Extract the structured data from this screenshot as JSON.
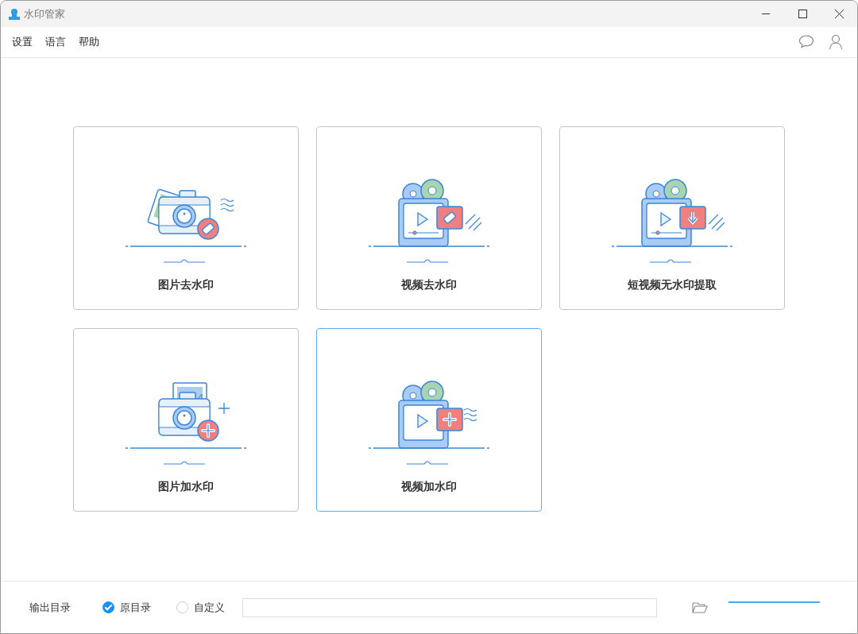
{
  "window": {
    "title": "水印管家"
  },
  "menu": [
    "设置",
    "语言",
    "帮助"
  ],
  "cards": [
    {
      "kind": "photo-remove",
      "label": "图片去水印",
      "selected": false
    },
    {
      "kind": "video-remove",
      "label": "视频去水印",
      "selected": false
    },
    {
      "kind": "video-extract",
      "label": "短视频无水印提取",
      "selected": false
    },
    {
      "kind": "photo-add",
      "label": "图片加水印",
      "selected": false
    },
    {
      "kind": "video-add",
      "label": "视频加水印",
      "selected": true
    }
  ],
  "output": {
    "label": "输出目录",
    "options": [
      {
        "label": "原目录",
        "selected": true
      },
      {
        "label": "自定义",
        "selected": false
      }
    ]
  }
}
